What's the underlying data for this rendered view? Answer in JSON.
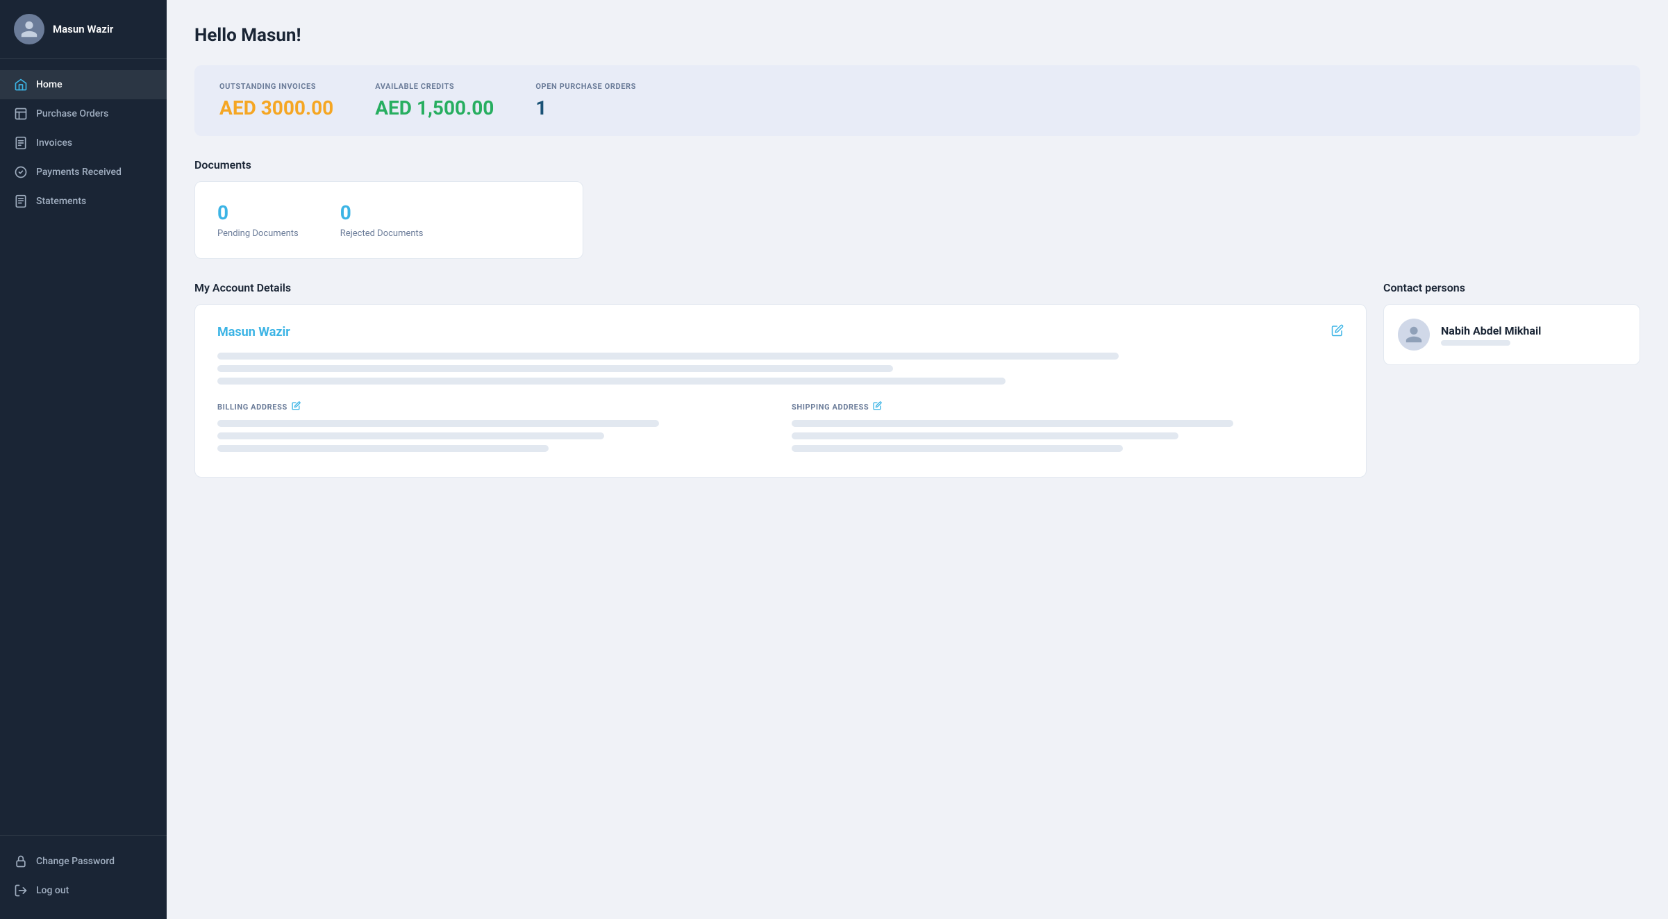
{
  "sidebar": {
    "username": "Masun Wazir",
    "nav_items": [
      {
        "id": "home",
        "label": "Home",
        "active": true
      },
      {
        "id": "purchase-orders",
        "label": "Purchase Orders",
        "active": false
      },
      {
        "id": "invoices",
        "label": "Invoices",
        "active": false
      },
      {
        "id": "payments-received",
        "label": "Payments Received",
        "active": false
      },
      {
        "id": "statements",
        "label": "Statements",
        "active": false
      }
    ],
    "footer_items": [
      {
        "id": "change-password",
        "label": "Change Password"
      },
      {
        "id": "logout",
        "label": "Log out"
      }
    ]
  },
  "header": {
    "greeting": "Hello Masun!"
  },
  "stats": {
    "outstanding_invoices_label": "OUTSTANDING INVOICES",
    "outstanding_invoices_value": "AED 3000.00",
    "available_credits_label": "AVAILABLE CREDITS",
    "available_credits_value": "AED 1,500.00",
    "open_purchase_orders_label": "OPEN PURCHASE ORDERS",
    "open_purchase_orders_value": "1"
  },
  "documents": {
    "section_title": "Documents",
    "pending_count": "0",
    "pending_label": "Pending Documents",
    "rejected_count": "0",
    "rejected_label": "Rejected Documents"
  },
  "account": {
    "section_title": "My Account Details",
    "name": "Masun Wazir",
    "billing_address_label": "BILLING ADDRESS",
    "shipping_address_label": "SHIPPING ADDRESS"
  },
  "contact": {
    "section_title": "Contact persons",
    "name": "Nabih Abdel Mikhail"
  },
  "icons": {
    "edit": "✎",
    "pencil_small": "✎"
  }
}
